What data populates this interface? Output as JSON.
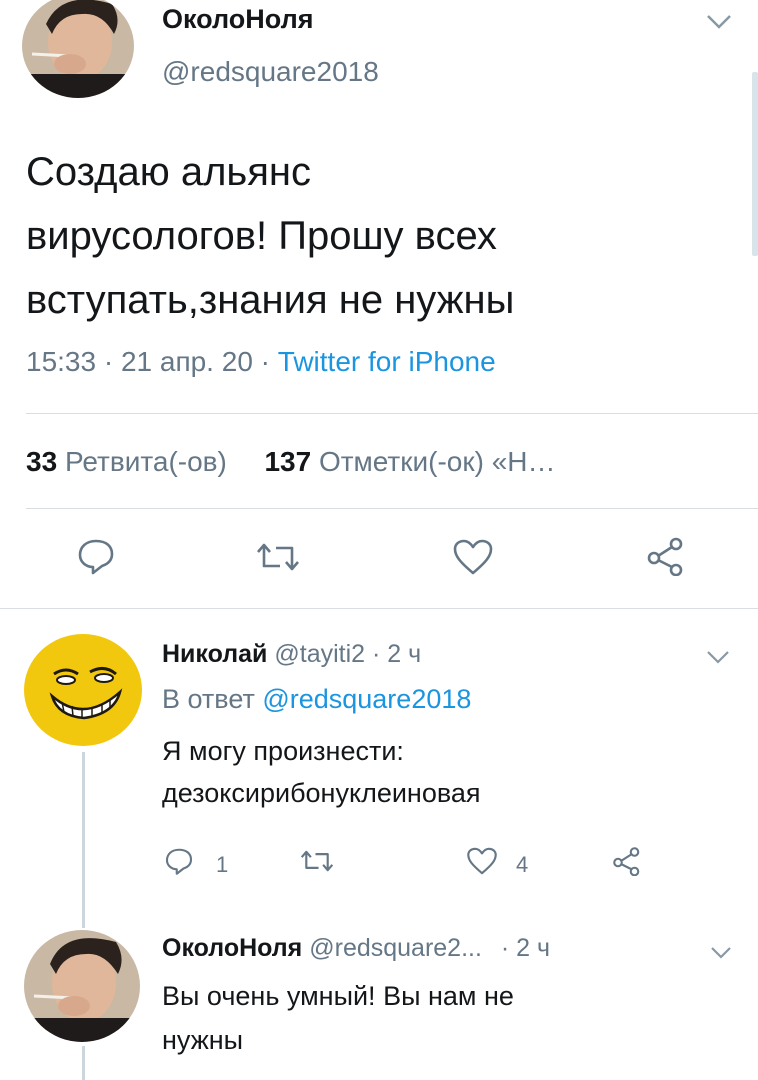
{
  "tweet": {
    "display_name": "ОколоНоля",
    "handle": "@redsquare2018",
    "text_lines": [
      "Создаю альянс",
      "вирусологов! Прошу всех",
      "вступать,знания не нужны"
    ],
    "meta_time": "15:33 · 21 апр. 20 · ",
    "meta_source": "Twitter for iPhone",
    "retweets_count": "33",
    "retweets_label": "Ретвита(-ов)",
    "likes_count": "137",
    "likes_label": "Отметки(-ок) «Н…"
  },
  "replies": [
    {
      "display_name": "Николай",
      "handle_time": "@tayiti2 · 2 ч",
      "reply_to_prefix": "В ответ ",
      "reply_to_handle": "@redsquare2018",
      "text_lines": [
        "Я могу произнести:",
        "дезоксирибонуклеиновая"
      ],
      "reply_count": "1",
      "like_count": "4"
    },
    {
      "display_name": "ОколоНоля",
      "handle": "@redsquare2...",
      "time": "· 2 ч",
      "text_lines": [
        "Вы очень умный! Вы нам не",
        "нужны"
      ]
    }
  ],
  "icons": {
    "reply": "reply-icon",
    "retweet": "retweet-icon",
    "like": "heart-icon",
    "share": "share-icon",
    "menu": "chevron-down-icon"
  },
  "colors": {
    "link": "#1b95e0",
    "muted": "#657786",
    "text": "#14171a",
    "divider": "#d9dee2"
  }
}
